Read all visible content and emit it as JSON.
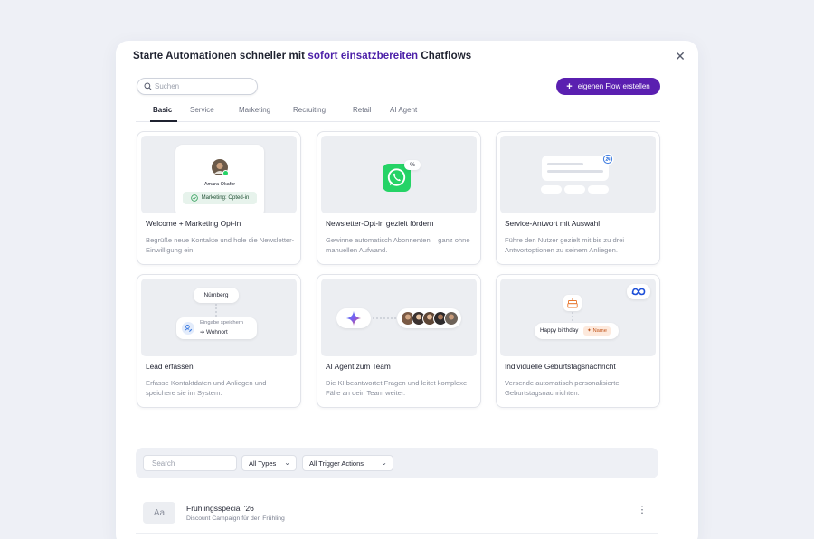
{
  "modal": {
    "title_prefix": "Starte Automationen schneller mit ",
    "title_accent": "sofort einsatzbereiten",
    "title_suffix": " Chatflows",
    "close_glyph": "✕"
  },
  "search": {
    "placeholder": "Suchen"
  },
  "create_button": {
    "label": "eigenen Flow erstellen",
    "icon": "plus-icon"
  },
  "tabs": [
    {
      "label": "Basic",
      "active": true
    },
    {
      "label": "Service"
    },
    {
      "label": "Marketing"
    },
    {
      "label": "Recruiting"
    },
    {
      "label": "Retail"
    },
    {
      "label": "AI Agent"
    }
  ],
  "cards": [
    {
      "title": "Welcome + Marketing Opt-in",
      "description": "Begrüße neue Kontakte und hole die Newsletter-Einwilligung ein.",
      "preview": {
        "contact_name": "Amara Okafor",
        "badge": "Marketing: Opted-in"
      }
    },
    {
      "title": "Newsletter-Opt-in gezielt fördern",
      "description": "Gewinne automatisch Abonnenten – ganz ohne manuellen Aufwand.",
      "preview": {
        "icon": "whatsapp-icon",
        "tag": "%"
      }
    },
    {
      "title": "Service-Antwort mit Auswahl",
      "description": "Führe den Nutzer gezielt mit bis zu drei Antwortoptionen zu seinem Anliegen.",
      "preview": {
        "icon": "chat-options-icon",
        "badge_icon": "24h-icon"
      }
    },
    {
      "title": "Lead erfassen",
      "description": "Erfasse Kontaktdaten und Anliegen und speichere sie im System.",
      "preview": {
        "city": "Nürnberg",
        "save_label": "Eingabe speichern",
        "save_target": "Wohnort"
      }
    },
    {
      "title": "AI Agent zum Team",
      "description": "Die KI beantwortet Fragen und leitet komplexe Fälle an dein Team weiter.",
      "preview": {
        "icon": "ai-sparkle-icon",
        "team_icon": "avatar-group-icon"
      }
    },
    {
      "title": "Individuelle Geburtstagsnachricht",
      "description": "Versende automatisch personalisierte Geburtstagsnachrichten.",
      "preview": {
        "icon": "cake-icon",
        "message": "Happy birthday",
        "variable": "Name",
        "badge_icon": "meta-icon"
      }
    }
  ],
  "filters": {
    "search_placeholder": "Search",
    "type_select": "All Types",
    "trigger_select": "All Trigger Actions"
  },
  "list": [
    {
      "thumb": "Aa",
      "title": "Frühlingsspecial '26",
      "subtitle": "Discount Campaign für den Frühling"
    }
  ],
  "colors": {
    "accent": "#5a1fb0",
    "whatsapp": "#25d366",
    "success": "#2e9e57"
  }
}
